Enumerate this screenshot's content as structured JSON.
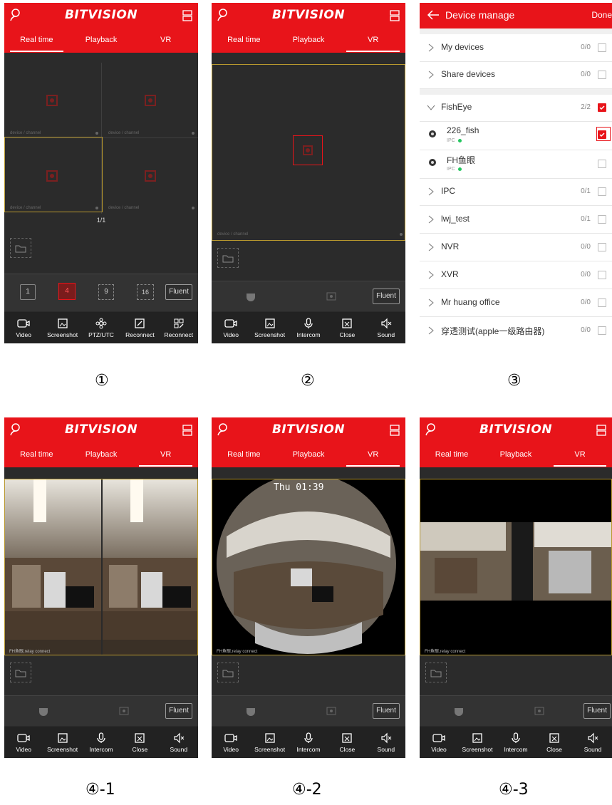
{
  "app": {
    "logo": "BITVISION",
    "tabs": [
      "Real time",
      "Playback",
      "VR"
    ]
  },
  "common": {
    "fluent": "Fluent",
    "channel_caption": "device / channel",
    "relay_caption": "FH鱼眼,relay connect"
  },
  "screen1": {
    "page_indicator": "1/1",
    "layout_buttons": [
      "1",
      "4",
      "9",
      "16"
    ],
    "toolbar": [
      "Video",
      "Screenshot",
      "PTZ/UTC",
      "Reconnect",
      "Reconnect"
    ]
  },
  "vr_toolbar": [
    "Video",
    "Screenshot",
    "Intercom",
    "Close",
    "Sound"
  ],
  "device_manage": {
    "title": "Device manage",
    "done": "Done",
    "groups": [
      {
        "name": "My devices",
        "count": "0/0"
      },
      {
        "name": "Share devices",
        "count": "0/0"
      },
      {
        "name": "FishEye",
        "count": "2/2"
      },
      {
        "name": "IPC",
        "count": "0/1"
      },
      {
        "name": "lwj_test",
        "count": "0/1"
      },
      {
        "name": "NVR",
        "count": "0/0"
      },
      {
        "name": "XVR",
        "count": "0/0"
      },
      {
        "name": "Mr huang office",
        "count": "0/0"
      },
      {
        "name": "穿透测试(apple一级路由器)",
        "count": "0/0"
      }
    ],
    "fisheye_devices": [
      {
        "name": "226_fish",
        "type": "IPC"
      },
      {
        "name": "FH鱼眼",
        "type": "IPC"
      }
    ]
  },
  "osd_time": "Thu 01:39",
  "captions": [
    "①",
    "②",
    "③",
    "④-1",
    "④-2",
    "④-3"
  ],
  "colors": {
    "brand_red": "#e8141a",
    "selection_gold": "#b8982e",
    "online_green": "#22c55e"
  }
}
